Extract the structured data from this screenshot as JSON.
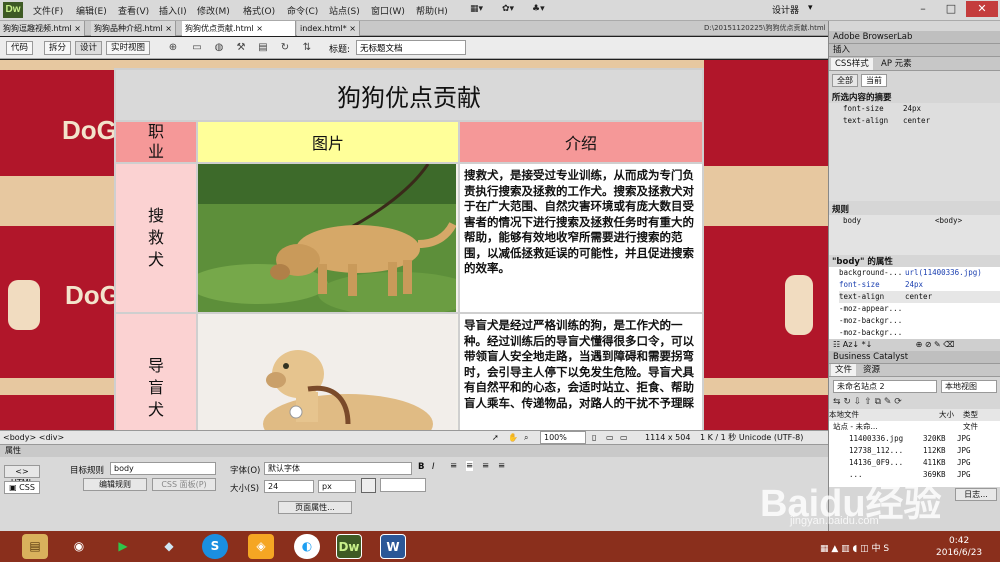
{
  "app": {
    "logo": "Dw"
  },
  "menu": [
    "文件(F)",
    "编辑(E)",
    "查看(V)",
    "插入(I)",
    "修改(M)",
    "格式(O)",
    "命令(C)",
    "站点(S)",
    "窗口(W)",
    "帮助(H)"
  ],
  "workspace": "设计器",
  "tabs": [
    {
      "label": "狗狗逗趣视频.html"
    },
    {
      "label": "狗狗品种介绍.html"
    },
    {
      "label": "狗狗优点贡献.html"
    },
    {
      "label": "index.html*"
    }
  ],
  "doc_path": "D:\\20151120225\\狗狗优点贡献.html",
  "views": [
    "代码",
    "拆分",
    "设计",
    "实时视图"
  ],
  "title_label": "标题:",
  "title_value": "无标题文档",
  "page": {
    "heading": "狗狗优点贡献",
    "col_job": "职业",
    "col_image": "图片",
    "col_desc": "介绍",
    "rows": [
      {
        "job": "搜救犬",
        "desc": "搜救犬，是接受过专业训练，从而成为专门负责执行搜索及拯救的工作犬。搜索及拯救犬对于在广大范围、自然灾害环境或有庞大数目受害者的情况下进行搜索及拯救任务时有重大的帮助，能够有效地收窄所需要进行搜索的范围，以减低拯救延误的可能性，并且促进搜索的效率。"
      },
      {
        "job": "导盲犬",
        "desc": "导盲犬是经过严格训练的狗，是工作犬的一种。经过训练后的导盲犬懂得很多口令，可以带领盲人安全地走路，当遇到障碍和需要拐弯时，会引导主人停下以免发生危险。导盲犬具有自然平和的心态，会适时站立、拒食、帮助盲人乘车、传递物品，对路人的干扰不予理睬"
      }
    ],
    "bg_text": "DoG"
  },
  "status": {
    "tags": "<body> <div>",
    "zoom": "100%",
    "size": "1114 x 504",
    "info": "1 K / 1 秒  Unicode (UTF-8)"
  },
  "props": {
    "title": "属性",
    "html_btn": "HTML",
    "css_btn": "CSS",
    "target_rule_label": "目标规则",
    "target_rule": "body",
    "edit_rule": "编辑规则",
    "css_panel": "CSS 面板(P)",
    "font_label": "字体(O)",
    "font_value": "默认字体",
    "size_label": "大小(S)",
    "size_value": "24",
    "size_unit": "px",
    "page_props": "页面属性..."
  },
  "right": {
    "browserlab": "Adobe BrowserLab",
    "insert": "插入",
    "css_tab": "CSS样式",
    "ap_tab": "AP 元素",
    "all_btn": "全部",
    "current_btn": "当前",
    "summary_title": "所选内容的摘要",
    "summary": [
      {
        "k": "font-size",
        "v": "24px"
      },
      {
        "k": "text-align",
        "v": "center"
      }
    ],
    "rules_title": "规则",
    "rules": [
      {
        "k": "body",
        "v": "<body>"
      }
    ],
    "props_title": "\"body\" 的属性",
    "properties": [
      {
        "k": "background-...",
        "v": "url(11400336.jpg)"
      },
      {
        "k": "font-size",
        "v": "24px"
      },
      {
        "k": "text-align",
        "v": "center"
      },
      {
        "k": "-moz-appear...",
        "v": ""
      },
      {
        "k": "-moz-backgr...",
        "v": ""
      },
      {
        "k": "-moz-backgr...",
        "v": ""
      }
    ],
    "bc": "Business Catalyst",
    "files_tab": "文件",
    "assets_tab": "资源",
    "site": "未命名站点 2",
    "view": "本地视图",
    "col_local": "本地文件",
    "col_size": "大小",
    "col_type": "类型",
    "root": "站点 - 未命...",
    "root_type": "文件",
    "files": [
      {
        "name": "11400336.jpg",
        "size": "320KB",
        "type": "JPG"
      },
      {
        "name": "12738_112...",
        "size": "112KB",
        "type": "JPG"
      },
      {
        "name": "14136_0F9...",
        "size": "411KB",
        "type": "JPG"
      },
      {
        "name": "...",
        "size": "369KB",
        "type": "JPG"
      }
    ],
    "log": "日志..."
  },
  "taskbar": {
    "time": "0:42",
    "date": "2016/6/23"
  },
  "watermark": {
    "main": "Baidu经验",
    "sub": "jingyan.baidu.com"
  }
}
